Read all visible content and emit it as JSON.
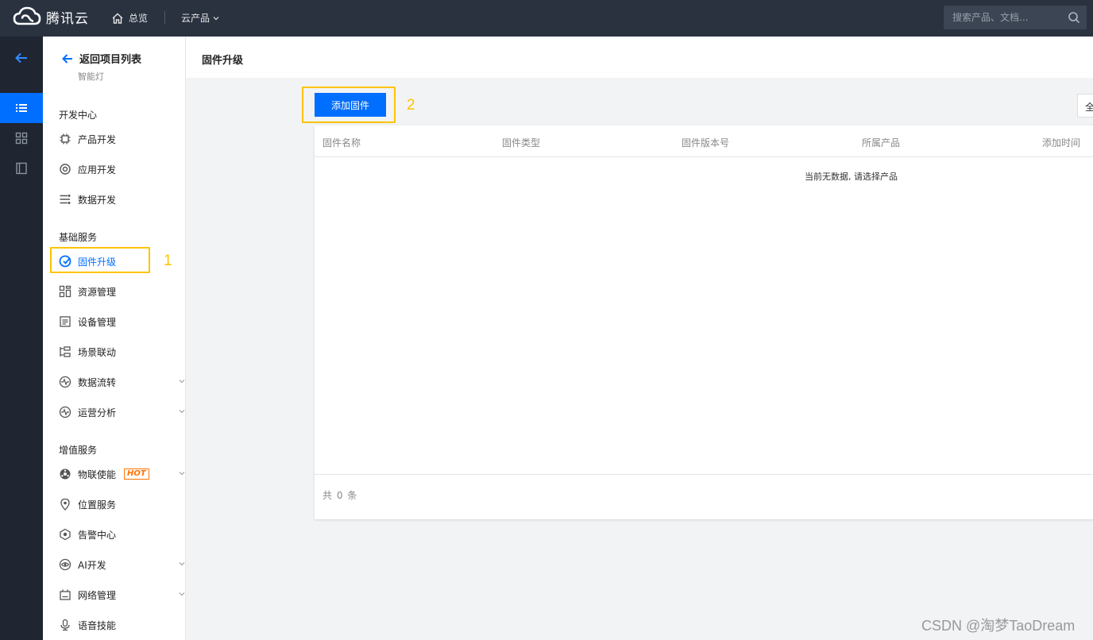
{
  "topbar": {
    "brand": "腾讯云",
    "overview": "总览",
    "products": "云产品",
    "search_placeholder": "搜索产品、文档..."
  },
  "sidebar": {
    "back_label": "返回项目列表",
    "project": "智能灯",
    "groups": [
      {
        "title": "开发中心",
        "items": [
          "产品开发",
          "应用开发",
          "数据开发"
        ]
      },
      {
        "title": "基础服务",
        "items": [
          "固件升级",
          "资源管理",
          "设备管理",
          "场景联动",
          "数据流转",
          "运营分析"
        ]
      },
      {
        "title": "增值服务",
        "items": [
          "物联使能",
          "位置服务",
          "告警中心",
          "AI开发",
          "网络管理",
          "语音技能"
        ]
      }
    ],
    "hot_badge": "HOT",
    "active_item": "固件升级"
  },
  "annotations": {
    "marker1": "1",
    "marker2": "2"
  },
  "main": {
    "title": "固件升级",
    "add_button": "添加固件",
    "filter_value": "全",
    "columns": [
      "固件名称",
      "固件类型",
      "固件版本号",
      "所属产品",
      "添加时间"
    ],
    "empty_text": "当前无数据, 请选择产品",
    "total": "共 0 条"
  },
  "watermark": "CSDN @淘梦TaoDream",
  "colors": {
    "accent": "#006eff",
    "highlight": "#ffc300",
    "topbar": "#2a3240",
    "rail": "#1f2531",
    "hot": "#ff7200"
  }
}
